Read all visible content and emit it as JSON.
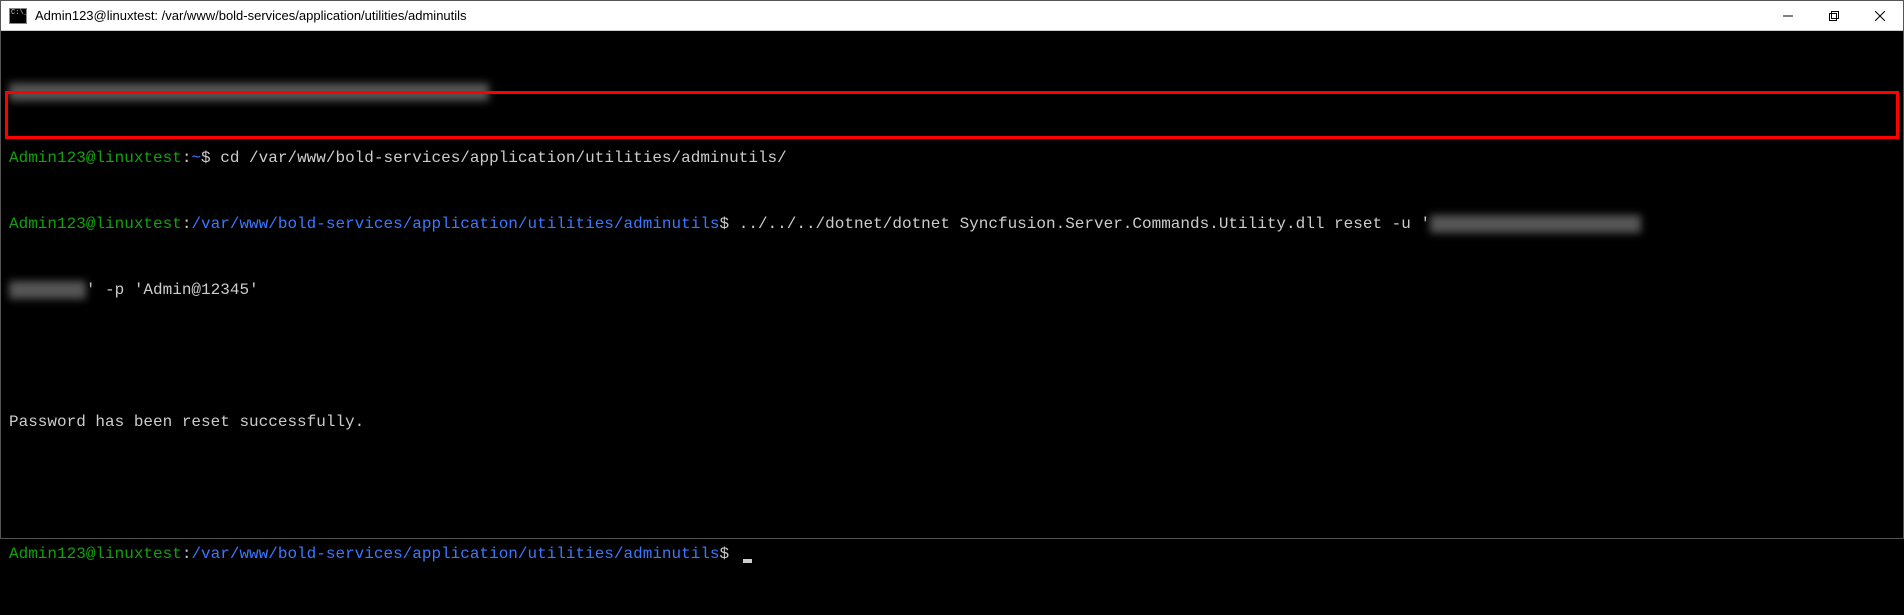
{
  "titlebar": {
    "title": "Admin123@linuxtest: /var/www/bold-services/application/utilities/adminutils"
  },
  "terminal": {
    "line0_censored": "████████████████████ █████████████████████████████",
    "line1": {
      "userhost": "Admin123@linuxtest",
      "colon": ":",
      "path": "~",
      "dollar": "$ ",
      "cmd": "cd /var/www/bold-services/application/utilities/adminutils/"
    },
    "line2": {
      "userhost": "Admin123@linuxtest",
      "colon": ":",
      "path": "/var/www/bold-services/application/utilities/adminutils",
      "dollar": "$ ",
      "cmd_part1": "../../../dotnet/dotnet Syncfusion.Server.Commands.Utility.dll reset -u '",
      "censored_user": "██████████████████████",
      "line2b_censored": "████████",
      "cmd_part2": "' -p 'Admin@12345'"
    },
    "blank": " ",
    "line3": "Password has been reset successfully.",
    "line4": {
      "userhost": "Admin123@linuxtest",
      "colon": ":",
      "path": "/var/www/bold-services/application/utilities/adminutils",
      "dollar": "$ "
    }
  }
}
